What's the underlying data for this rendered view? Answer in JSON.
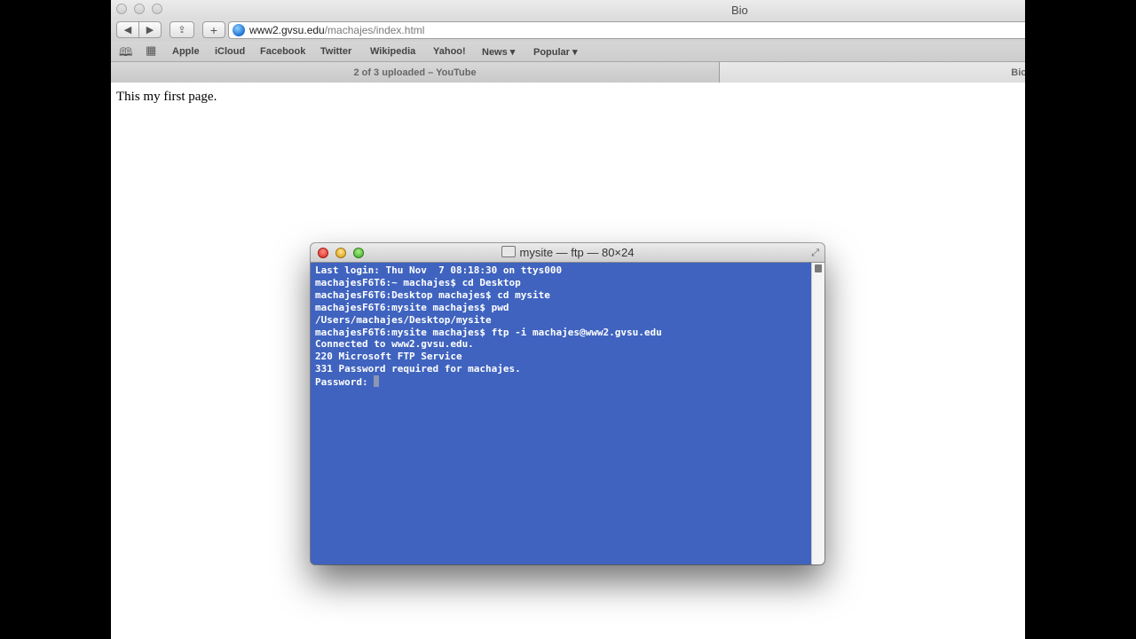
{
  "browser": {
    "window_title": "Bio",
    "url": {
      "host": "www2.gvsu.edu",
      "path": "/machajes/index.html"
    },
    "bookmarks": [
      "Apple",
      "iCloud",
      "Facebook",
      "Twitter",
      "Wikipedia",
      "Yahoo!",
      "News ▾",
      "Popular ▾"
    ],
    "tabs": [
      {
        "title": "2 of 3 uploaded – YouTube",
        "active": false
      },
      {
        "title": "Bio",
        "active": true
      }
    ]
  },
  "page": {
    "text": "This my first page."
  },
  "terminal": {
    "title": "mysite — ftp — 80×24",
    "lines": [
      "Last login: Thu Nov  7 08:18:30 on ttys000",
      "machajesF6T6:~ machajes$ cd Desktop",
      "machajesF6T6:Desktop machajes$ cd mysite",
      "machajesF6T6:mysite machajes$ pwd",
      "/Users/machajes/Desktop/mysite",
      "machajesF6T6:mysite machajes$ ftp -i machajes@www2.gvsu.edu",
      "Connected to www2.gvsu.edu.",
      "220 Microsoft FTP Service",
      "331 Password required for machajes."
    ],
    "prompt": "Password: ",
    "background_color": "#3f63bf"
  },
  "icons": {
    "back": "◀",
    "forward": "▶",
    "share": "⇪",
    "new_tab": "+",
    "reading_list": "📖",
    "top_sites": "▦",
    "resize": "⤢"
  }
}
